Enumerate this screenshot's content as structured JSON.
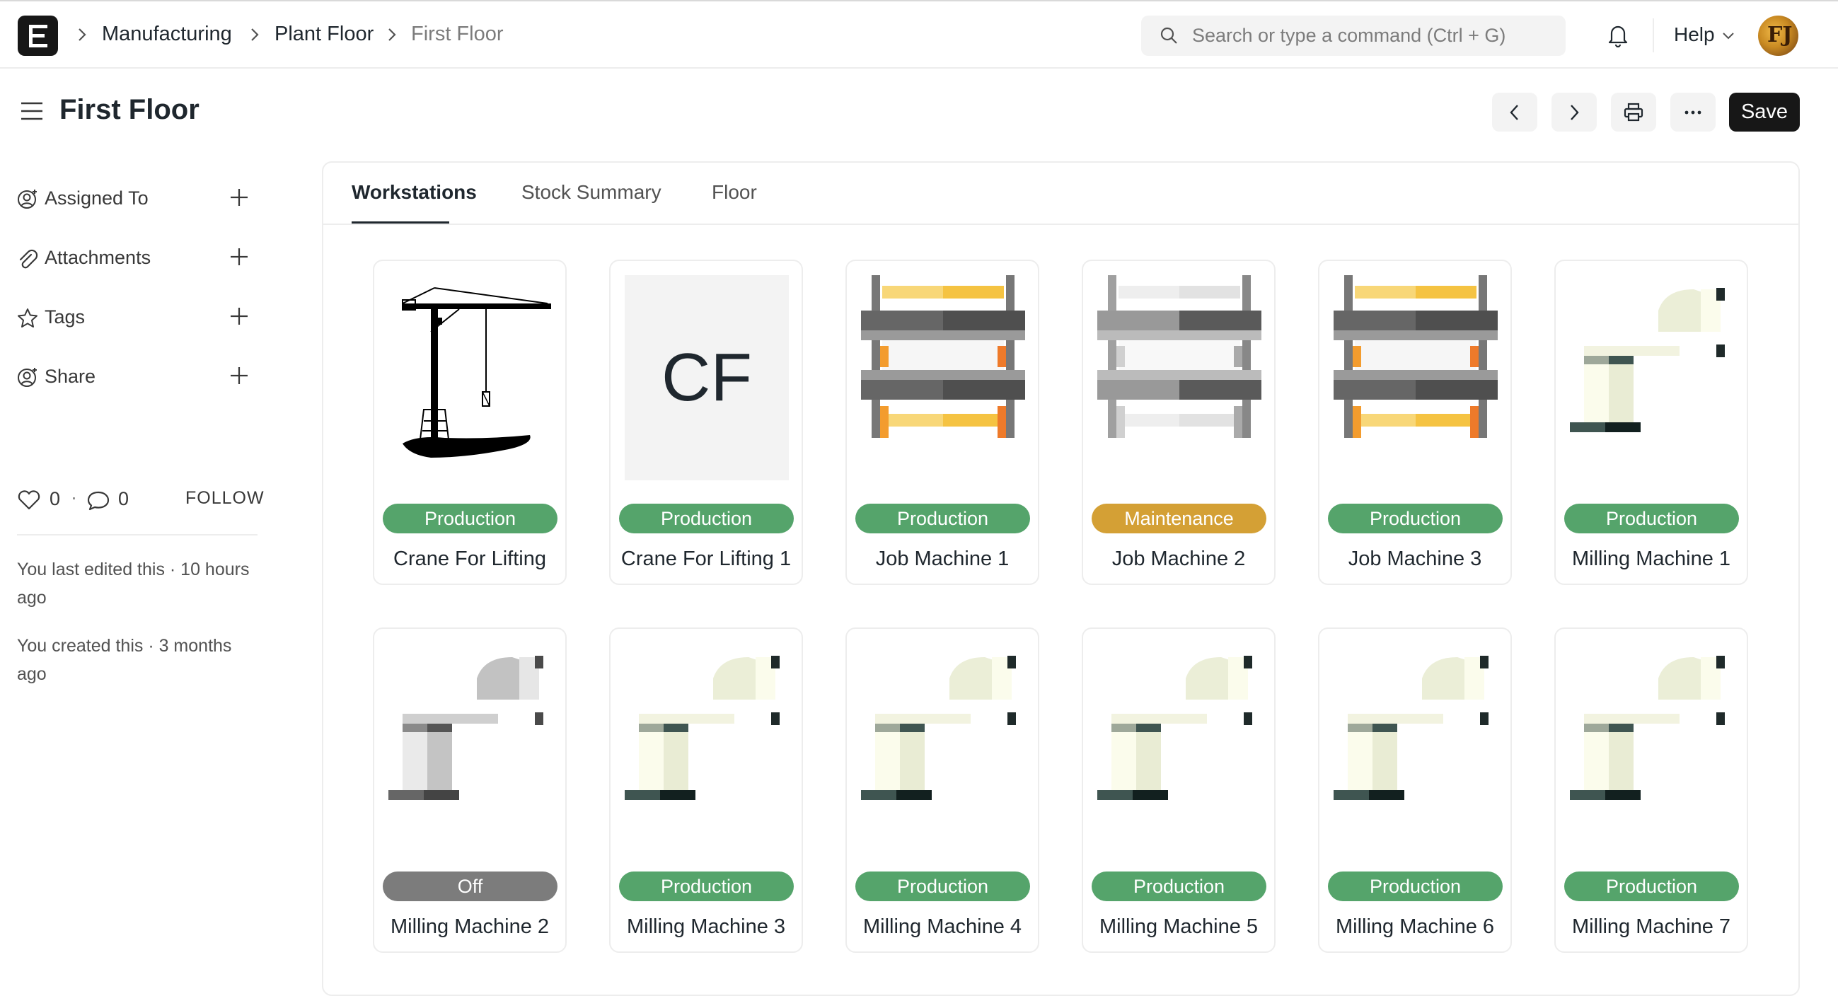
{
  "navbar": {
    "breadcrumbs": [
      "Manufacturing",
      "Plant Floor",
      "First Floor"
    ],
    "search_placeholder": "Search or type a command (Ctrl + G)",
    "help_label": "Help",
    "avatar_initials": "FJ"
  },
  "page": {
    "title": "First Floor",
    "save_label": "Save"
  },
  "sidebar": {
    "items": [
      {
        "label": "Assigned To",
        "icon": "assign-user-icon"
      },
      {
        "label": "Attachments",
        "icon": "paperclip-icon"
      },
      {
        "label": "Tags",
        "icon": "star-icon"
      },
      {
        "label": "Share",
        "icon": "share-user-icon"
      }
    ],
    "likes": "0",
    "comments": "0",
    "follow_label": "FOLLOW",
    "last_edited": "You last edited this · 10 hours ago",
    "created": "You created this · 3 months ago"
  },
  "tabs": [
    {
      "label": "Workstations",
      "active": true
    },
    {
      "label": "Stock Summary",
      "active": false
    },
    {
      "label": "Floor",
      "active": false
    }
  ],
  "status_colors": {
    "Production": "#55a46b",
    "Maintenance": "#d4a035",
    "Off": "#7c7c7c"
  },
  "workstations": [
    {
      "name": "Crane For Lifting",
      "status": "Production",
      "image": "crane"
    },
    {
      "name": "Crane For Lifting 1",
      "status": "Production",
      "image": "placeholder",
      "initials": "CF"
    },
    {
      "name": "Job Machine 1",
      "status": "Production",
      "image": "job-machine"
    },
    {
      "name": "Job Machine 2",
      "status": "Maintenance",
      "image": "job-machine-grey"
    },
    {
      "name": "Job Machine 3",
      "status": "Production",
      "image": "job-machine"
    },
    {
      "name": "Milling Machine 1",
      "status": "Production",
      "image": "milling-machine"
    },
    {
      "name": "Milling Machine 2",
      "status": "Off",
      "image": "milling-machine-grey"
    },
    {
      "name": "Milling Machine 3",
      "status": "Production",
      "image": "milling-machine"
    },
    {
      "name": "Milling Machine 4",
      "status": "Production",
      "image": "milling-machine"
    },
    {
      "name": "Milling Machine 5",
      "status": "Production",
      "image": "milling-machine"
    },
    {
      "name": "Milling Machine 6",
      "status": "Production",
      "image": "milling-machine"
    },
    {
      "name": "Milling Machine 7",
      "status": "Production",
      "image": "milling-machine"
    }
  ]
}
